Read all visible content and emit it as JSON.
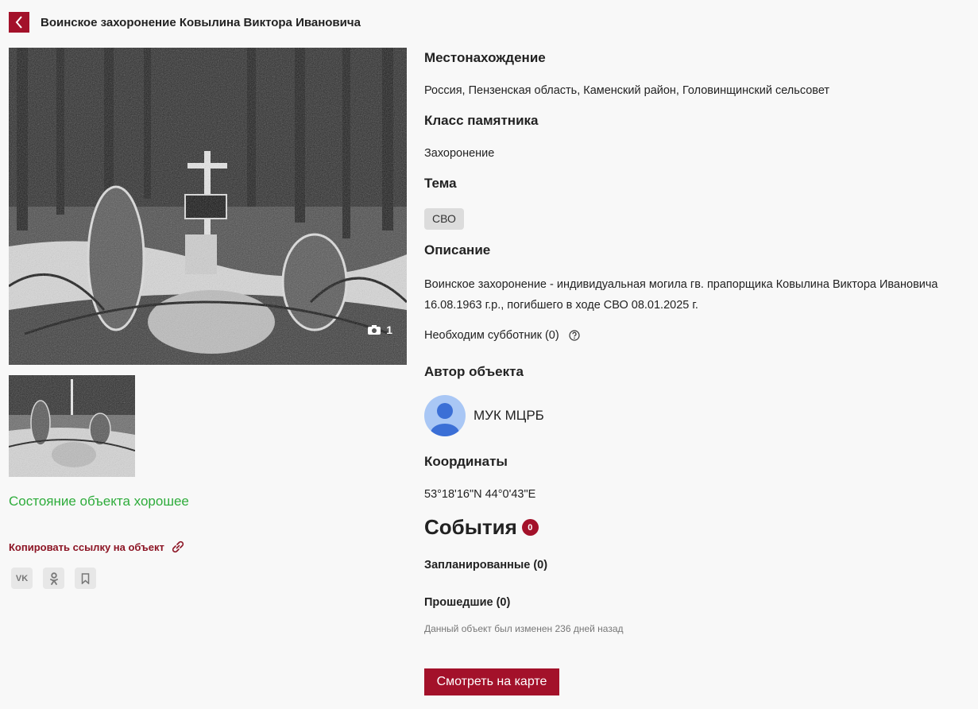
{
  "header": {
    "title": "Воинское захоронение Ковылина Виктора Ивановича"
  },
  "gallery": {
    "photo_count": "1"
  },
  "status": {
    "text": "Состояние объекта хорошее"
  },
  "actions": {
    "copy_link": "Копировать ссылку на объект"
  },
  "share": {
    "vk": "VK",
    "ok": "OK",
    "bookmark": "bookmark-icon"
  },
  "details": {
    "location_label": "Местонахождение",
    "location_value": "Россия, Пензенская область, Каменский район, Головинщинский сельсовет",
    "class_label": "Класс памятника",
    "class_value": "Захоронение",
    "theme_label": "Тема",
    "theme_tag": "СВО",
    "description_label": "Описание",
    "description_line1": "Воинское захоронение - индивидуальная могила гв. прапорщика Ковылина Виктора Ивановича",
    "description_line2": "16.08.1963 г.р., погибшего в ходе СВО 08.01.2025 г.",
    "subbotnik": "Необходим субботник (0)",
    "author_label": "Автор объекта",
    "author_name": "МУК МЦРБ",
    "coords_label": "Координаты",
    "coords_value": "53°18'16\"N 44°0'43\"E"
  },
  "events": {
    "title": "События",
    "count": "0",
    "planned": "Запланированные (0)",
    "past": "Прошедшие (0)",
    "modified_note": "Данный объект был изменен 236 дней назад"
  },
  "map_button": "Смотреть на карте",
  "colors": {
    "accent": "#a3112a",
    "status_ok": "#2eac3b",
    "link": "#8c1424"
  }
}
